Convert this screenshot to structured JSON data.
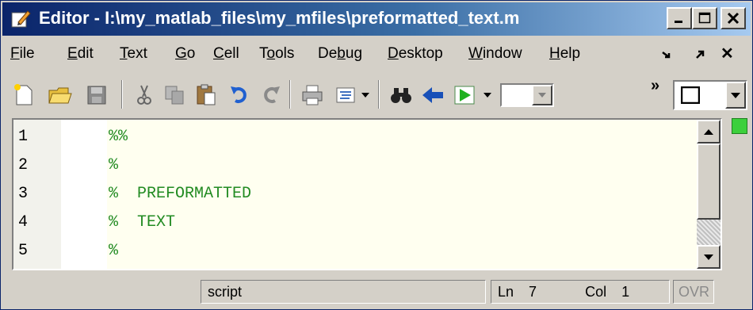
{
  "window": {
    "title": "Editor - I:\\my_matlab_files\\my_mfiles\\preformatted_text.m"
  },
  "window_controls": {
    "minimize": "_",
    "maximize": "□",
    "close": "X"
  },
  "menu": {
    "items": [
      {
        "label": "File",
        "mnemonic": "F",
        "rest": "ile"
      },
      {
        "label": "Edit",
        "mnemonic": "E",
        "rest": "dit"
      },
      {
        "label": "Text",
        "mnemonic": "T",
        "rest": "ext"
      },
      {
        "label": "Go",
        "mnemonic": "G",
        "rest": "o"
      },
      {
        "label": "Cell",
        "mnemonic": "C",
        "rest": "ell"
      },
      {
        "label": "Tools",
        "pre": "T",
        "mnemonic": "o",
        "rest": "ols"
      },
      {
        "label": "Debug",
        "pre": "De",
        "mnemonic": "b",
        "rest": "ug"
      },
      {
        "label": "Desktop",
        "mnemonic": "D",
        "rest": "esktop"
      },
      {
        "label": "Window",
        "mnemonic": "W",
        "rest": "indow"
      },
      {
        "label": "Help",
        "mnemonic": "H",
        "rest": "elp"
      }
    ],
    "right_icons": [
      "undock-icon",
      "dock-arrow-icon",
      "close-icon"
    ],
    "close_glyph": "✕"
  },
  "toolbar": {
    "icons": [
      "new-file-icon",
      "open-folder-icon",
      "save-icon",
      "cut-icon",
      "copy-icon",
      "paste-icon",
      "undo-icon",
      "redo-icon",
      "print-icon",
      "format-icon",
      "find-icon",
      "back-arrow-icon",
      "run-icon"
    ],
    "overflow": "»"
  },
  "editor": {
    "lines": [
      {
        "num": "1",
        "text": "%%"
      },
      {
        "num": "2",
        "text": "%"
      },
      {
        "num": "3",
        "text": "%  PREFORMATTED"
      },
      {
        "num": "4",
        "text": "%  TEXT"
      },
      {
        "num": "5",
        "text": "%"
      }
    ],
    "comment_color": "#228b22",
    "background": "#fffff0"
  },
  "status": {
    "mode": "script",
    "ln_label": "Ln",
    "ln_value": "7",
    "col_label": "Col",
    "col_value": "1",
    "ovr": "OVR"
  }
}
